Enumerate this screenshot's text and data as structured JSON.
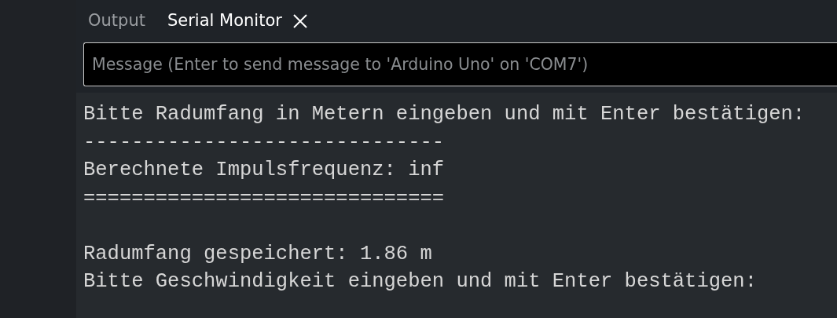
{
  "tabs": [
    {
      "label": "Output",
      "selected": false,
      "closable": false
    },
    {
      "label": "Serial Monitor",
      "selected": true,
      "closable": true
    }
  ],
  "message_field": {
    "placeholder": "Message (Enter to send message to 'Arduino Uno' on 'COM7')"
  },
  "output": {
    "blocks": [
      [
        "Bitte Radumfang in Metern eingeben und mit Enter bestätigen:",
        "------------------------------",
        "Berechnete Impulsfrequenz: inf",
        "=============================="
      ],
      [
        "Radumfang gespeichert: 1.86 m",
        "Bitte Geschwindigkeit eingeben und mit Enter bestätigen:"
      ]
    ]
  }
}
